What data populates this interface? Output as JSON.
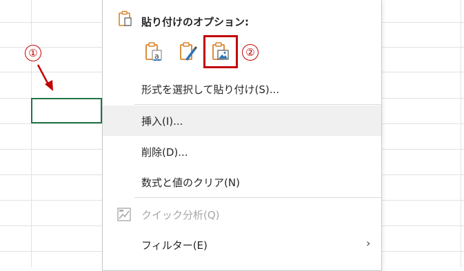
{
  "annotations": {
    "marker_1": "①",
    "marker_2": "②"
  },
  "context_menu": {
    "paste_options_title": "貼り付けのオプション:",
    "paste_options": [
      {
        "icon": "paste-values-icon"
      },
      {
        "icon": "paste-formatting-icon"
      },
      {
        "icon": "paste-picture-icon"
      }
    ],
    "items": [
      {
        "label": "形式を選択して貼り付け(S)..."
      },
      {
        "label": "挿入(I)..."
      },
      {
        "label": "削除(D)..."
      },
      {
        "label": "数式と値のクリア(N)"
      },
      {
        "label": "クイック分析(Q)"
      },
      {
        "label": "フィルター(E)"
      }
    ],
    "submenu_chevron": "›"
  },
  "colors": {
    "accent_red": "#c00000",
    "selection_green": "#217346",
    "icon_orange": "#d9822b",
    "icon_blue": "#2e75b6"
  }
}
